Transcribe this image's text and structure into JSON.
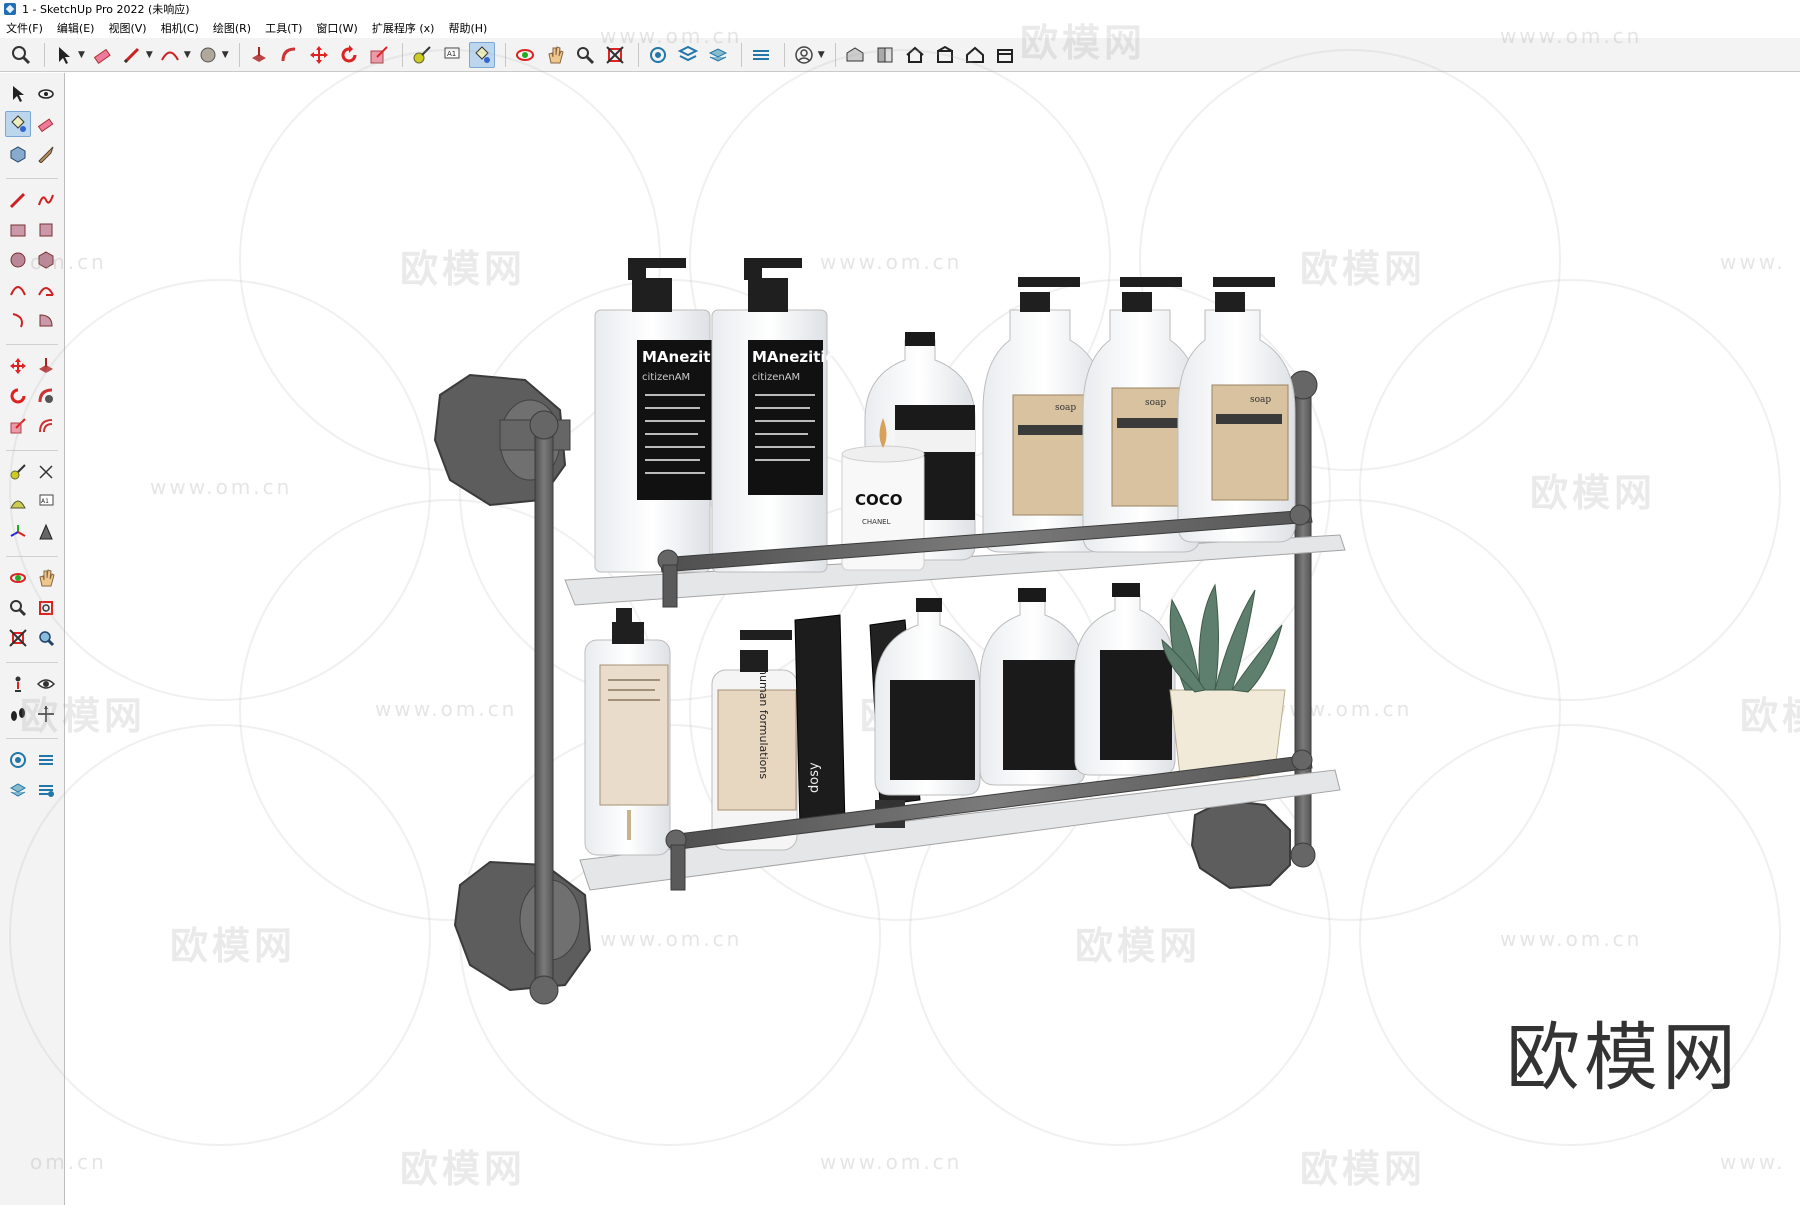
{
  "window": {
    "title": "1 - SketchUp Pro 2022 (未响应)"
  },
  "menu": [
    "文件(F)",
    "编辑(E)",
    "视图(V)",
    "相机(C)",
    "绘图(R)",
    "工具(T)",
    "窗口(W)",
    "扩展程序 (x)",
    "帮助(H)"
  ],
  "watermark": {
    "brand": "欧模网",
    "url": "www.om.cn",
    "url_fragment": "om.cn",
    "url_fragment_right": "www."
  },
  "products": {
    "top": {
      "pump_a_brand": "MAnezitic",
      "pump_a_brand2": "citizenAM",
      "pump_b_brand": "MAnezitic",
      "pump_b_brand2": "citizenAM",
      "candle_label": "COCO",
      "candle_sub": "CHANEL",
      "amber_label": "soap"
    },
    "bottom": {
      "tube_label": "dosy",
      "bottle_label": "human formulations"
    }
  },
  "icons": {
    "toolbar": [
      "zoom-icon",
      "select-icon",
      "eraser-icon",
      "pencil-icon",
      "arc-icon",
      "circle-icon",
      "push-pull-icon",
      "follow-me-icon",
      "move-icon",
      "rotate-icon",
      "scale-icon",
      "tape-measure-icon",
      "text-icon",
      "paint-bucket-icon",
      "orbit-icon",
      "pan-icon",
      "zoom-window-icon",
      "zoom-extents-icon",
      "section-plane-icon",
      "layers-icon",
      "styles-icon",
      "shadows-icon",
      "account-icon",
      "warehouse-icon",
      "components-icon",
      "home-icon",
      "extension-icon",
      "house-icon",
      "box-icon"
    ],
    "sidebar": [
      "select-icon",
      "orbit-icon",
      "paint-bucket-icon",
      "eraser-icon",
      "components-icon",
      "tag-icon",
      "pencil-icon",
      "freehand-icon",
      "rectangle-icon",
      "rotated-rect-icon",
      "circle-icon",
      "polygon-icon",
      "arc-icon",
      "pie-icon",
      "arc3-icon",
      "arc2-icon",
      "move-icon",
      "push-pull-icon",
      "rotate-icon",
      "follow-me-icon",
      "scale-icon",
      "offset-icon",
      "tape-measure-icon",
      "dimension-icon",
      "protractor-icon",
      "text-icon",
      "axes-icon",
      "3d-text-icon",
      "orbit-icon",
      "pan-icon",
      "zoom-icon",
      "zoom-window-icon",
      "zoom-extents-icon",
      "previous-icon",
      "position-camera-icon",
      "look-around-icon",
      "walk-icon",
      "section-plane-icon",
      "display-section-icon",
      "section-cut-icon",
      "section-fill-icon",
      "tags-icon"
    ]
  }
}
